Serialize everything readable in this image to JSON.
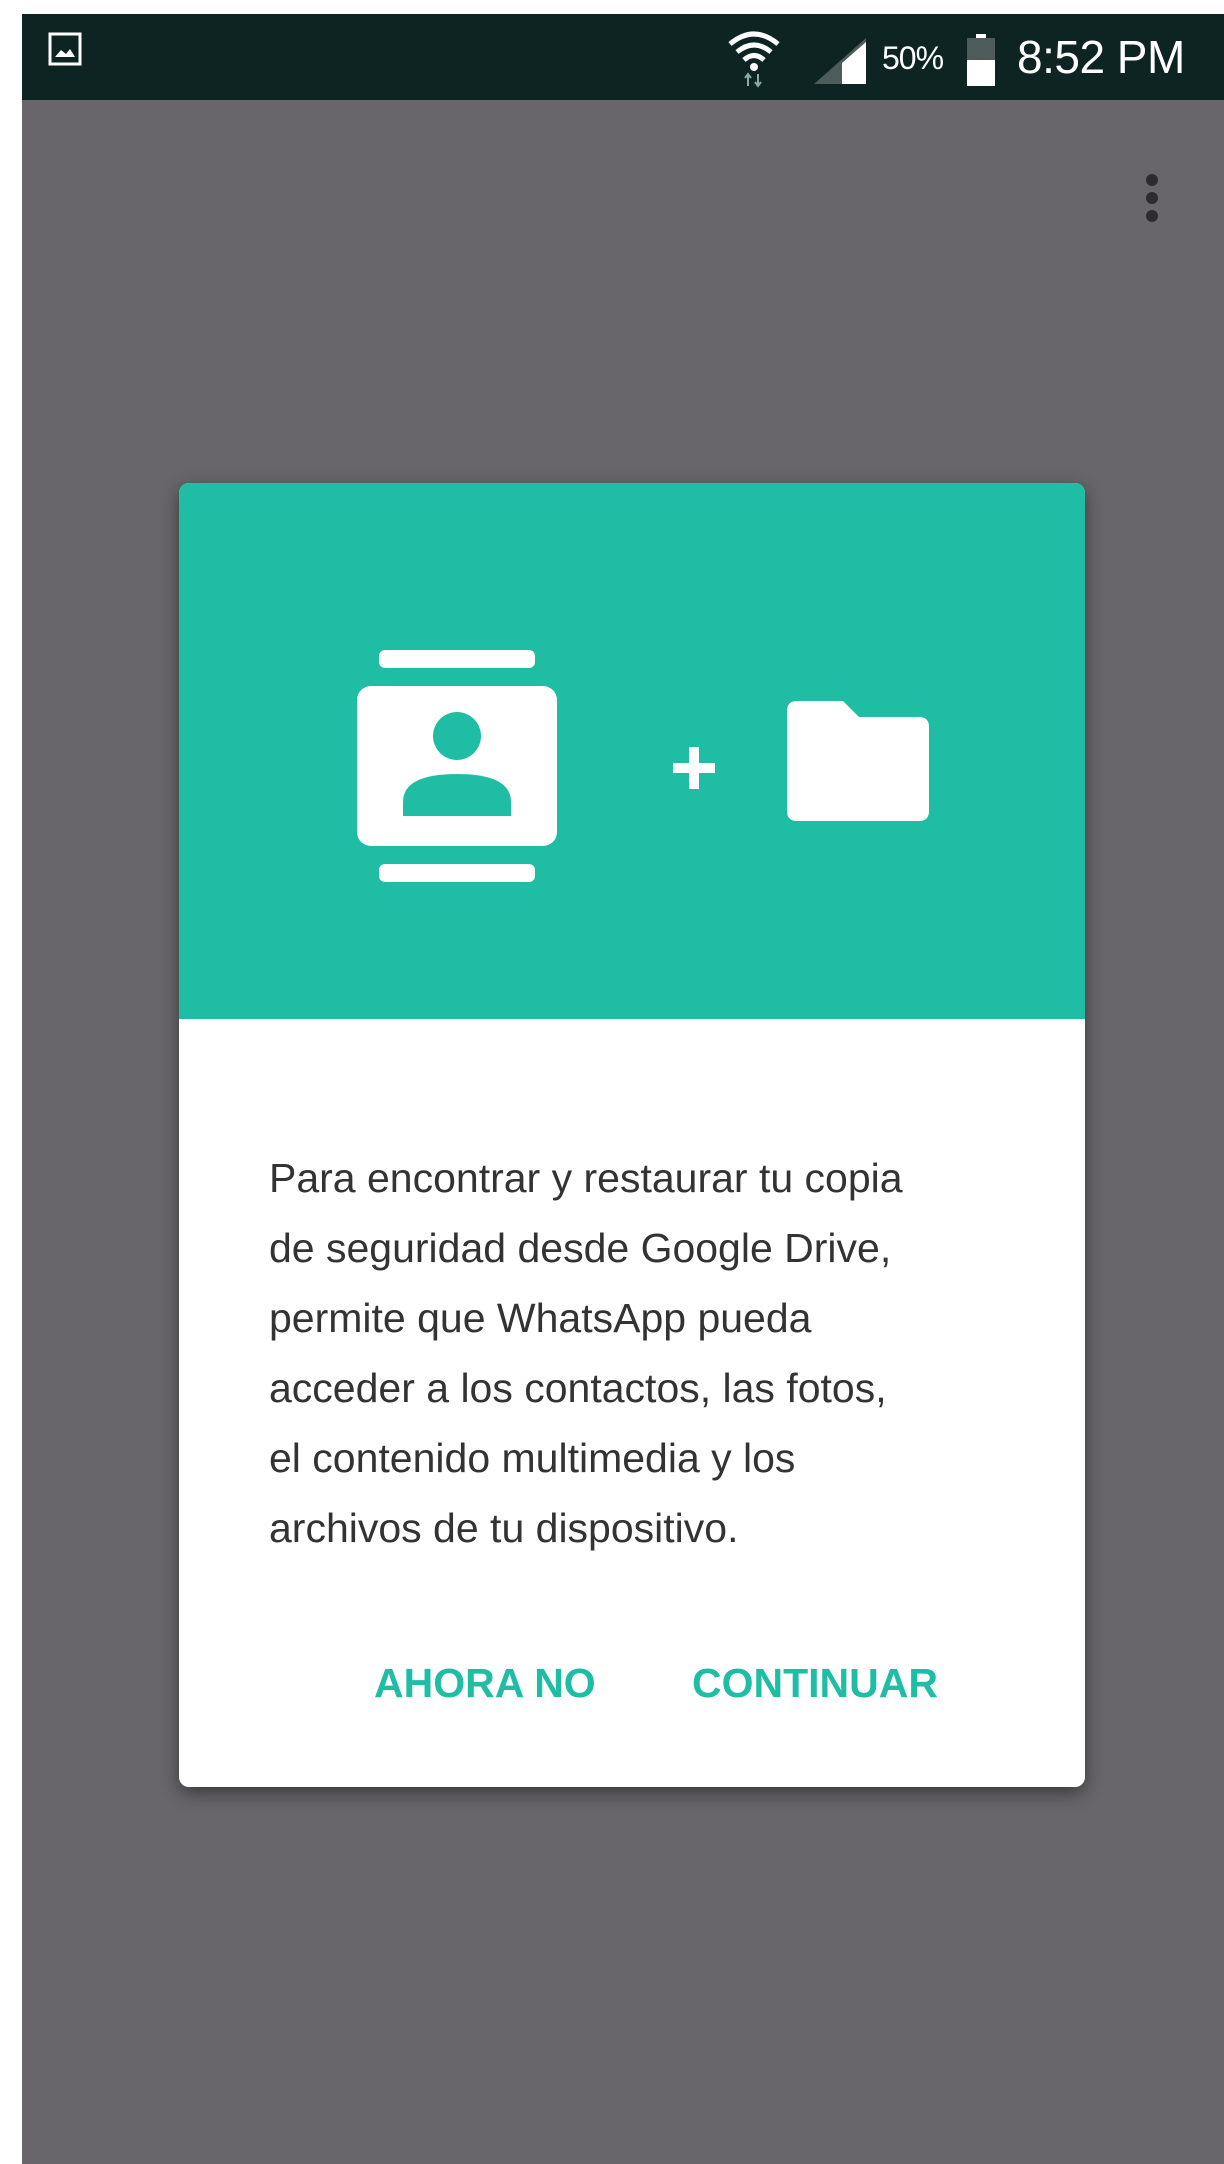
{
  "status_bar": {
    "battery_percent": "50%",
    "time": "8:52 PM",
    "icons": [
      "gallery-icon",
      "wifi-icon",
      "signal-icon",
      "battery-icon"
    ]
  },
  "toolbar": {
    "overflow_icon": "more-vert-icon"
  },
  "dialog": {
    "header_icons": [
      "contacts-icon",
      "plus-icon",
      "folder-icon"
    ],
    "message": "Para encontrar y restaurar tu copia de seguridad desde Google Drive, permite que WhatsApp pueda acceder a los contactos, las fotos, el contenido multimedia y los archivos de tu dispositivo.",
    "message_lines": [
      "Para encontrar y restaurar tu copia",
      "de seguridad desde Google Drive,",
      "permite que WhatsApp pueda",
      "acceder a los contactos, las fotos,",
      "el contenido multimedia y los",
      "archivos de tu dispositivo."
    ],
    "secondary_button": "AHORA NO",
    "primary_button": "CONTINUAR"
  },
  "colors": {
    "accent": "#1fbea4",
    "status_bar": "#0e2423",
    "scrim": "#68666a",
    "text": "#333333"
  }
}
